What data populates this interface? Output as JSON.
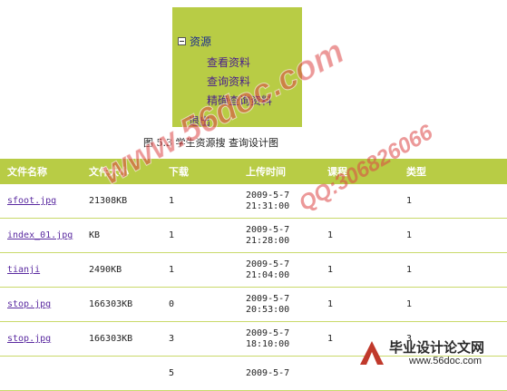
{
  "menu": {
    "root_label": "资源",
    "items": [
      "查看资料",
      "查询资料",
      "精确查询资料"
    ],
    "exit_label": "退出",
    "colors": {
      "panel_bg": "#b8cc45",
      "item_text": "#4a1f8c"
    }
  },
  "figure_caption": "图 5.3  学生资源搜 查询设计图",
  "table": {
    "headers": [
      "文件名称",
      "文件大小",
      "下载",
      "上传时间",
      "课程",
      "类型"
    ],
    "rows": [
      {
        "name": "sfoot.jpg",
        "size": "21308KB",
        "downloads": "1",
        "date": "2009-5-7",
        "time": "21:31:00",
        "course": "",
        "type": "1"
      },
      {
        "name": "index_01.jpg",
        "size": "KB",
        "downloads": "1",
        "date": "2009-5-7",
        "time": "21:28:00",
        "course": "1",
        "type": "1"
      },
      {
        "name": "tianji",
        "size": "2490KB",
        "downloads": "1",
        "date": "2009-5-7",
        "time": "21:04:00",
        "course": "1",
        "type": "1"
      },
      {
        "name": "stop.jpg",
        "size": "166303KB",
        "downloads": "0",
        "date": "2009-5-7",
        "time": "20:53:00",
        "course": "1",
        "type": "1"
      },
      {
        "name": "stop.jpg",
        "size": "166303KB",
        "downloads": "3",
        "date": "2009-5-7",
        "time": "18:10:00",
        "course": "1",
        "type": "3"
      },
      {
        "name": "",
        "size": "",
        "downloads": "5",
        "date": "2009-5-7",
        "time": "",
        "course": "",
        "type": ""
      }
    ],
    "colors": {
      "header_bg": "#b8cc45",
      "header_text": "#ffffff",
      "link": "#5a2aa0"
    }
  },
  "watermarks": {
    "site": "www.56doc.com",
    "qq": "QQ:306826066",
    "stamp_title": "毕业设计论文网",
    "stamp_url": "www.56doc.com"
  }
}
